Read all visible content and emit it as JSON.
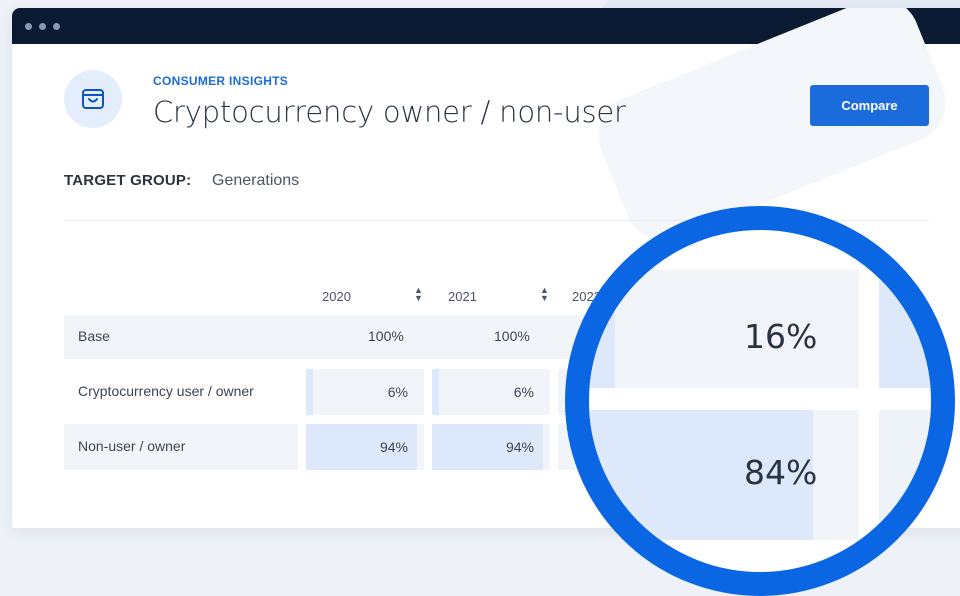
{
  "window": {
    "controls": [
      "close",
      "minimize",
      "maximize"
    ]
  },
  "header": {
    "icon": "shopping-bag-icon",
    "eyebrow": "CONSUMER INSIGHTS",
    "title": "Cryptocurrency owner / non-user",
    "compare_label": "Compare"
  },
  "target_group": {
    "label": "TARGET GROUP:",
    "value": "Generations"
  },
  "table": {
    "columns": [
      "2020",
      "2021",
      "2022"
    ],
    "rows": [
      {
        "label": "Base",
        "values": [
          "100%",
          "100%"
        ]
      },
      {
        "label": "Cryptocurrency user / owner",
        "values": [
          "6%",
          "6%"
        ],
        "fractions": [
          0.06,
          0.06
        ]
      },
      {
        "label": "Non-user / owner",
        "values": [
          "94%",
          "94%"
        ],
        "fractions": [
          0.94,
          0.94
        ]
      }
    ]
  },
  "zoom": {
    "values": [
      "16%",
      "84%"
    ],
    "fractions": [
      0.16,
      0.84
    ]
  },
  "colors": {
    "accent": "#1a6cdc",
    "ring": "#0a66e3",
    "titlebar": "#0b1a33",
    "cell_bg": "#f1f5fa",
    "cell_fill": "#dde9fa"
  }
}
